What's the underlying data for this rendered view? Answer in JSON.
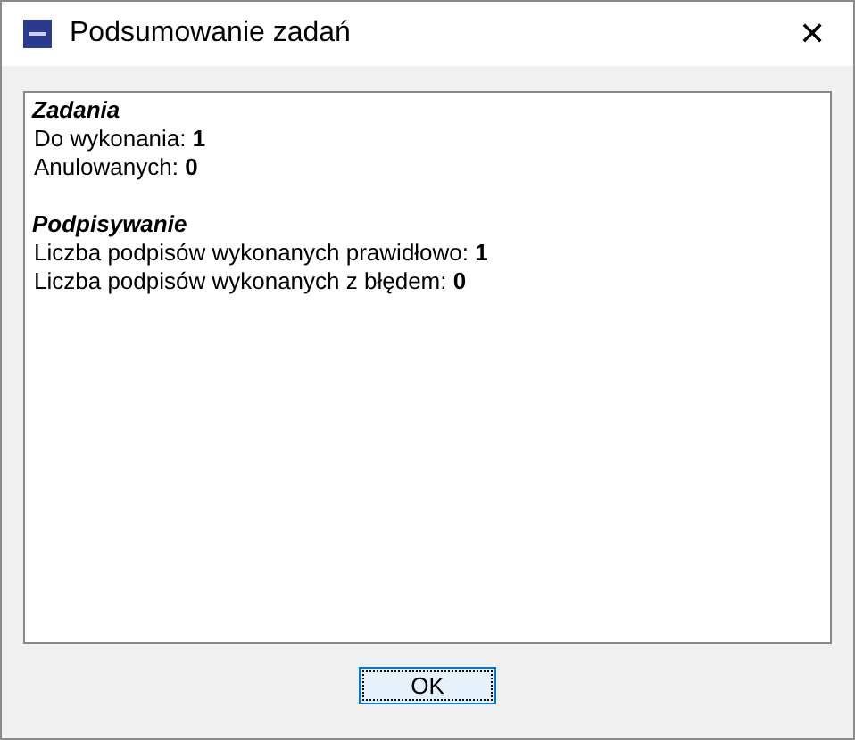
{
  "window": {
    "title": "Podsumowanie zadań",
    "close": "✕"
  },
  "sections": [
    {
      "heading": "Zadania",
      "lines": [
        {
          "label": "Do wykonania:",
          "value": "1"
        },
        {
          "label": "Anulowanych:",
          "value": "0"
        }
      ]
    },
    {
      "heading": "Podpisywanie",
      "lines": [
        {
          "label": "Liczba podpisów wykonanych prawidłowo:",
          "value": "1"
        },
        {
          "label": "Liczba podpisów wykonanych z błędem:",
          "value": "0"
        }
      ]
    }
  ],
  "buttons": [
    {
      "label": "OK",
      "focused": true
    }
  ]
}
